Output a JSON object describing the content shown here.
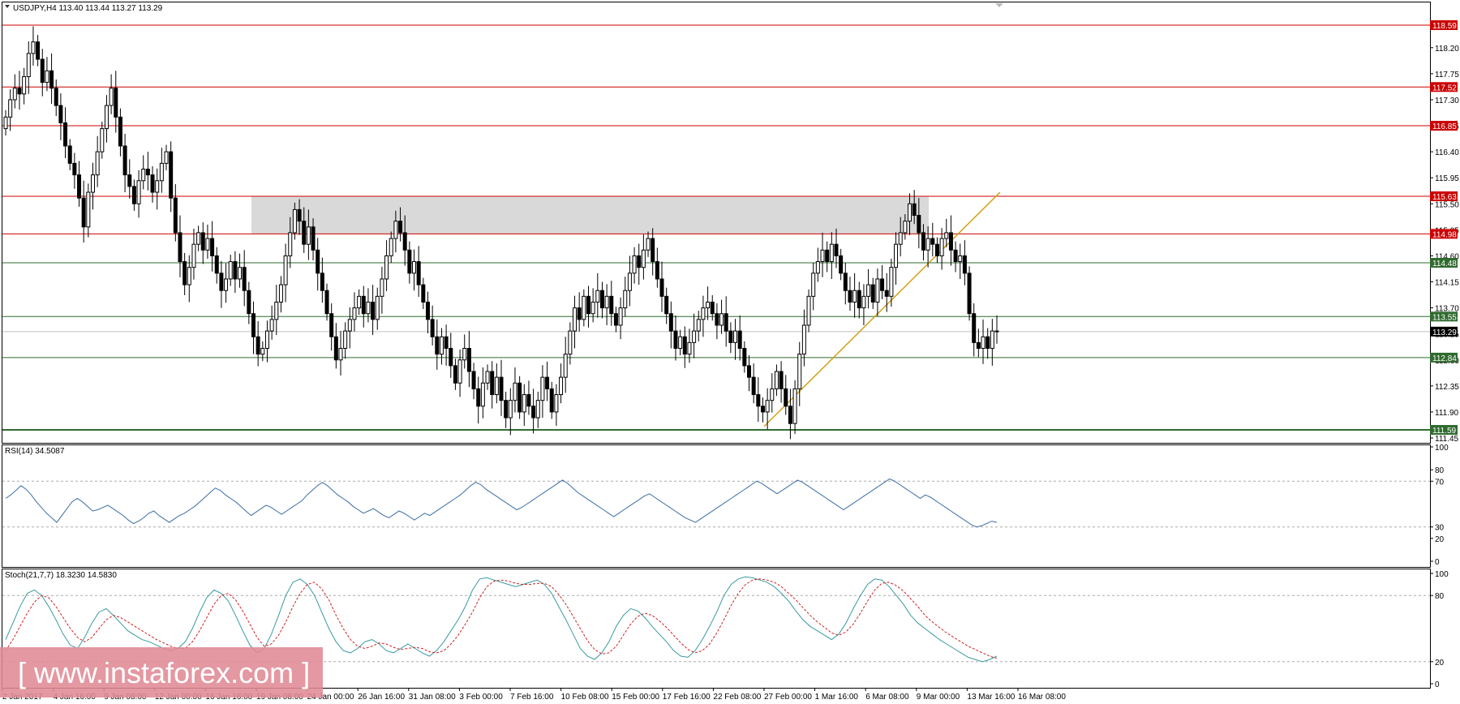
{
  "header": {
    "symbol_line": "USDJPY,H4  113.40 113.44 113.27 113.29",
    "rsi_label": "RSI(14) 34.5087",
    "stoch_label": "Stoch(21,7,7) 18.3230 14.5830"
  },
  "watermark": "[ www.instaforex.com ]",
  "colors": {
    "resistance": "#cc0000",
    "support": "#2f6b2f",
    "trend": "#d4a017",
    "zone": "#d9d9d9",
    "candle_up": "#000000",
    "candle_down": "#000000",
    "rsi": "#3b6ea5",
    "stoch_main": "#3a9aa0",
    "stoch_signal": "#cc2222"
  },
  "chart_data": [
    {
      "type": "candlestick",
      "symbol": "USDJPY",
      "timeframe": "H4",
      "ohlc_last": {
        "open": 113.4,
        "high": 113.44,
        "low": 113.27,
        "close": 113.29
      },
      "ylim": [
        111.45,
        118.59
      ],
      "y_ticks": [
        "118.20",
        "117.75",
        "117.30",
        "116.85",
        "116.40",
        "115.95",
        "115.50",
        "115.05",
        "114.60",
        "114.15",
        "113.70",
        "113.25",
        "112.80",
        "112.35",
        "111.90",
        "111.45"
      ],
      "x_ticks": [
        "2 Jan 2017",
        "4 Jan 16:00",
        "9 Jan 08:00",
        "12 Jan 00:00",
        "16 Jan 16:00",
        "19 Jan 08:00",
        "24 Jan 00:00",
        "26 Jan 16:00",
        "31 Jan 08:00",
        "3 Feb 00:00",
        "7 Feb 16:00",
        "10 Feb 08:00",
        "15 Feb 00:00",
        "17 Feb 16:00",
        "22 Feb 08:00",
        "27 Feb 00:00",
        "1 Mar 16:00",
        "6 Mar 08:00",
        "9 Mar 00:00",
        "13 Mar 16:00",
        "16 Mar 08:00"
      ],
      "levels": [
        {
          "value": 118.59,
          "label": "118.59",
          "kind": "resistance"
        },
        {
          "value": 117.52,
          "label": "117.52",
          "kind": "resistance"
        },
        {
          "value": 116.85,
          "label": "116.85",
          "kind": "resistance"
        },
        {
          "value": 115.63,
          "label": "115.63",
          "kind": "resistance"
        },
        {
          "value": 114.98,
          "label": "114.98",
          "kind": "resistance"
        },
        {
          "value": 114.48,
          "label": "114.48",
          "kind": "support"
        },
        {
          "value": 113.55,
          "label": "113.55",
          "kind": "support"
        },
        {
          "value": 112.84,
          "label": "112.84",
          "kind": "support"
        },
        {
          "value": 111.59,
          "label": "111.59",
          "kind": "support"
        }
      ],
      "current_price": {
        "value": 113.29,
        "label": "113.29"
      },
      "zone": {
        "from": 114.98,
        "to": 115.63
      },
      "trendline": {
        "from": 111.65,
        "to": 115.7
      },
      "close_series": [
        117.0,
        117.3,
        117.5,
        117.4,
        117.7,
        118.1,
        118.3,
        118.0,
        117.6,
        117.8,
        117.5,
        117.2,
        116.9,
        116.5,
        116.2,
        116.0,
        115.6,
        115.1,
        115.7,
        116.0,
        116.4,
        116.8,
        117.2,
        117.5,
        117.0,
        116.5,
        116.0,
        115.8,
        115.5,
        115.9,
        116.1,
        116.0,
        115.7,
        115.9,
        116.2,
        116.4,
        115.6,
        115.0,
        114.5,
        114.1,
        114.4,
        114.8,
        115.0,
        114.7,
        114.9,
        114.6,
        114.3,
        114.0,
        114.2,
        114.5,
        114.2,
        114.4,
        114.0,
        113.6,
        113.2,
        112.9,
        113.0,
        113.3,
        113.5,
        113.8,
        114.1,
        114.6,
        115.0,
        115.4,
        115.2,
        114.8,
        115.1,
        114.7,
        114.3,
        114.0,
        113.6,
        113.2,
        112.8,
        113.0,
        113.3,
        113.5,
        113.7,
        113.9,
        113.6,
        113.8,
        113.5,
        113.9,
        114.2,
        114.6,
        114.9,
        115.2,
        115.0,
        114.7,
        114.3,
        114.5,
        114.1,
        113.8,
        113.5,
        113.2,
        112.9,
        113.2,
        113.0,
        112.7,
        112.4,
        112.8,
        113.0,
        112.6,
        112.3,
        112.0,
        112.4,
        112.6,
        112.2,
        112.5,
        112.1,
        111.8,
        112.1,
        112.4,
        111.9,
        112.2,
        112.0,
        111.8,
        112.1,
        112.5,
        112.3,
        111.9,
        112.2,
        112.5,
        112.9,
        113.3,
        113.7,
        113.5,
        113.9,
        113.6,
        113.8,
        114.0,
        113.7,
        113.9,
        113.6,
        113.4,
        113.7,
        114.0,
        114.3,
        114.6,
        114.4,
        114.7,
        114.9,
        114.5,
        114.2,
        113.9,
        113.6,
        113.3,
        113.0,
        113.2,
        112.9,
        113.1,
        113.3,
        113.5,
        113.7,
        113.8,
        113.6,
        113.4,
        113.6,
        113.3,
        113.1,
        113.3,
        113.0,
        112.7,
        112.5,
        112.2,
        112.0,
        111.9,
        112.1,
        112.3,
        112.6,
        112.3,
        112.0,
        111.7,
        112.3,
        112.9,
        113.4,
        113.9,
        114.3,
        114.5,
        114.7,
        114.5,
        114.8,
        114.6,
        114.3,
        114.0,
        113.8,
        114.0,
        113.7,
        113.9,
        114.1,
        113.8,
        114.2,
        114.0,
        113.9,
        114.4,
        114.8,
        115.0,
        115.2,
        115.5,
        115.3,
        115.0,
        114.7,
        114.9,
        114.8,
        114.6,
        114.9,
        115.0,
        114.7,
        114.5,
        114.6,
        114.3,
        113.6,
        113.1,
        113.0,
        113.2,
        113.0,
        113.3,
        113.29
      ],
      "title": "",
      "xlabel": "",
      "ylabel": ""
    },
    {
      "type": "line",
      "name": "RSI(14)",
      "ylim": [
        0,
        100
      ],
      "y_ticks": [
        "100",
        "80",
        "70",
        "30",
        "20",
        "0"
      ],
      "guides": [
        70,
        30
      ],
      "series": [
        {
          "name": "RSI(14)",
          "values": [
            55,
            58,
            62,
            66,
            63,
            58,
            52,
            47,
            42,
            38,
            34,
            40,
            46,
            52,
            55,
            52,
            48,
            44,
            45,
            47,
            49,
            46,
            43,
            40,
            36,
            33,
            35,
            38,
            42,
            44,
            40,
            37,
            34,
            37,
            40,
            42,
            45,
            48,
            52,
            56,
            60,
            64,
            62,
            58,
            55,
            52,
            48,
            44,
            40,
            43,
            46,
            49,
            47,
            44,
            41,
            44,
            47,
            50,
            53,
            58,
            62,
            66,
            69,
            66,
            62,
            58,
            55,
            52,
            48,
            45,
            42,
            44,
            46,
            43,
            40,
            38,
            41,
            44,
            42,
            39,
            36,
            39,
            42,
            40,
            43,
            46,
            49,
            52,
            55,
            58,
            62,
            66,
            69,
            67,
            63,
            60,
            57,
            54,
            51,
            48,
            45,
            47,
            50,
            53,
            56,
            59,
            62,
            65,
            68,
            71,
            68,
            64,
            60,
            57,
            54,
            51,
            48,
            45,
            42,
            39,
            42,
            45,
            48,
            51,
            54,
            57,
            59,
            56,
            53,
            50,
            47,
            44,
            41,
            38,
            36,
            34,
            37,
            40,
            43,
            46,
            49,
            52,
            55,
            58,
            61,
            64,
            67,
            70,
            68,
            65,
            62,
            59,
            62,
            65,
            68,
            71,
            69,
            66,
            63,
            60,
            57,
            54,
            51,
            48,
            45,
            48,
            51,
            54,
            57,
            60,
            63,
            66,
            69,
            72,
            70,
            67,
            64,
            61,
            58,
            55,
            58,
            56,
            53,
            50,
            47,
            44,
            41,
            38,
            35,
            32,
            30,
            31,
            33,
            35,
            34
          ]
        }
      ]
    },
    {
      "type": "line",
      "name": "Stoch(21,7,7)",
      "ylim": [
        0,
        100
      ],
      "y_ticks": [
        "100",
        "80",
        "20",
        "0"
      ],
      "guides": [
        80,
        20
      ],
      "series": [
        {
          "name": "Stoch main",
          "values": [
            40,
            55,
            70,
            82,
            85,
            80,
            70,
            58,
            45,
            35,
            32,
            42,
            55,
            65,
            68,
            62,
            55,
            48,
            44,
            40,
            38,
            35,
            32,
            30,
            32,
            38,
            50,
            65,
            78,
            85,
            82,
            75,
            62,
            48,
            35,
            28,
            32,
            45,
            62,
            80,
            92,
            95,
            90,
            80,
            65,
            50,
            38,
            30,
            28,
            32,
            38,
            40,
            36,
            30,
            28,
            32,
            36,
            32,
            28,
            25,
            30,
            38,
            48,
            58,
            70,
            85,
            95,
            96,
            94,
            92,
            90,
            88,
            90,
            92,
            94,
            90,
            82,
            70,
            58,
            45,
            32,
            25,
            22,
            28,
            38,
            52,
            62,
            68,
            66,
            60,
            52,
            45,
            38,
            30,
            25,
            24,
            30,
            40,
            52,
            65,
            80,
            90,
            95,
            97,
            96,
            94,
            92,
            88,
            82,
            75,
            66,
            58,
            52,
            48,
            44,
            40,
            45,
            55,
            68,
            80,
            90,
            95,
            94,
            88,
            80,
            72,
            62,
            55,
            50,
            45,
            40,
            36,
            32,
            28,
            24,
            22,
            20,
            22,
            25
          ]
        },
        {
          "name": "Stoch signal",
          "values": [
            30,
            40,
            52,
            64,
            74,
            80,
            78,
            70,
            60,
            50,
            42,
            38,
            42,
            50,
            58,
            62,
            60,
            56,
            52,
            48,
            44,
            40,
            37,
            34,
            32,
            32,
            38,
            48,
            60,
            72,
            80,
            82,
            76,
            66,
            54,
            42,
            34,
            36,
            44,
            56,
            70,
            82,
            90,
            92,
            86,
            76,
            62,
            50,
            40,
            34,
            32,
            34,
            37,
            36,
            33,
            31,
            32,
            33,
            32,
            29,
            28,
            30,
            36,
            44,
            54,
            65,
            78,
            88,
            93,
            94,
            93,
            91,
            90,
            90,
            91,
            91,
            88,
            81,
            72,
            61,
            50,
            39,
            31,
            27,
            28,
            34,
            44,
            54,
            61,
            64,
            62,
            57,
            51,
            44,
            37,
            31,
            28,
            30,
            36,
            46,
            58,
            71,
            82,
            90,
            94,
            95,
            94,
            92,
            88,
            82,
            76,
            69,
            62,
            56,
            51,
            46,
            44,
            47,
            54,
            64,
            75,
            85,
            91,
            92,
            89,
            84,
            77,
            70,
            62,
            56,
            51,
            46,
            42,
            38,
            34,
            31,
            28,
            25,
            23
          ]
        }
      ]
    }
  ]
}
